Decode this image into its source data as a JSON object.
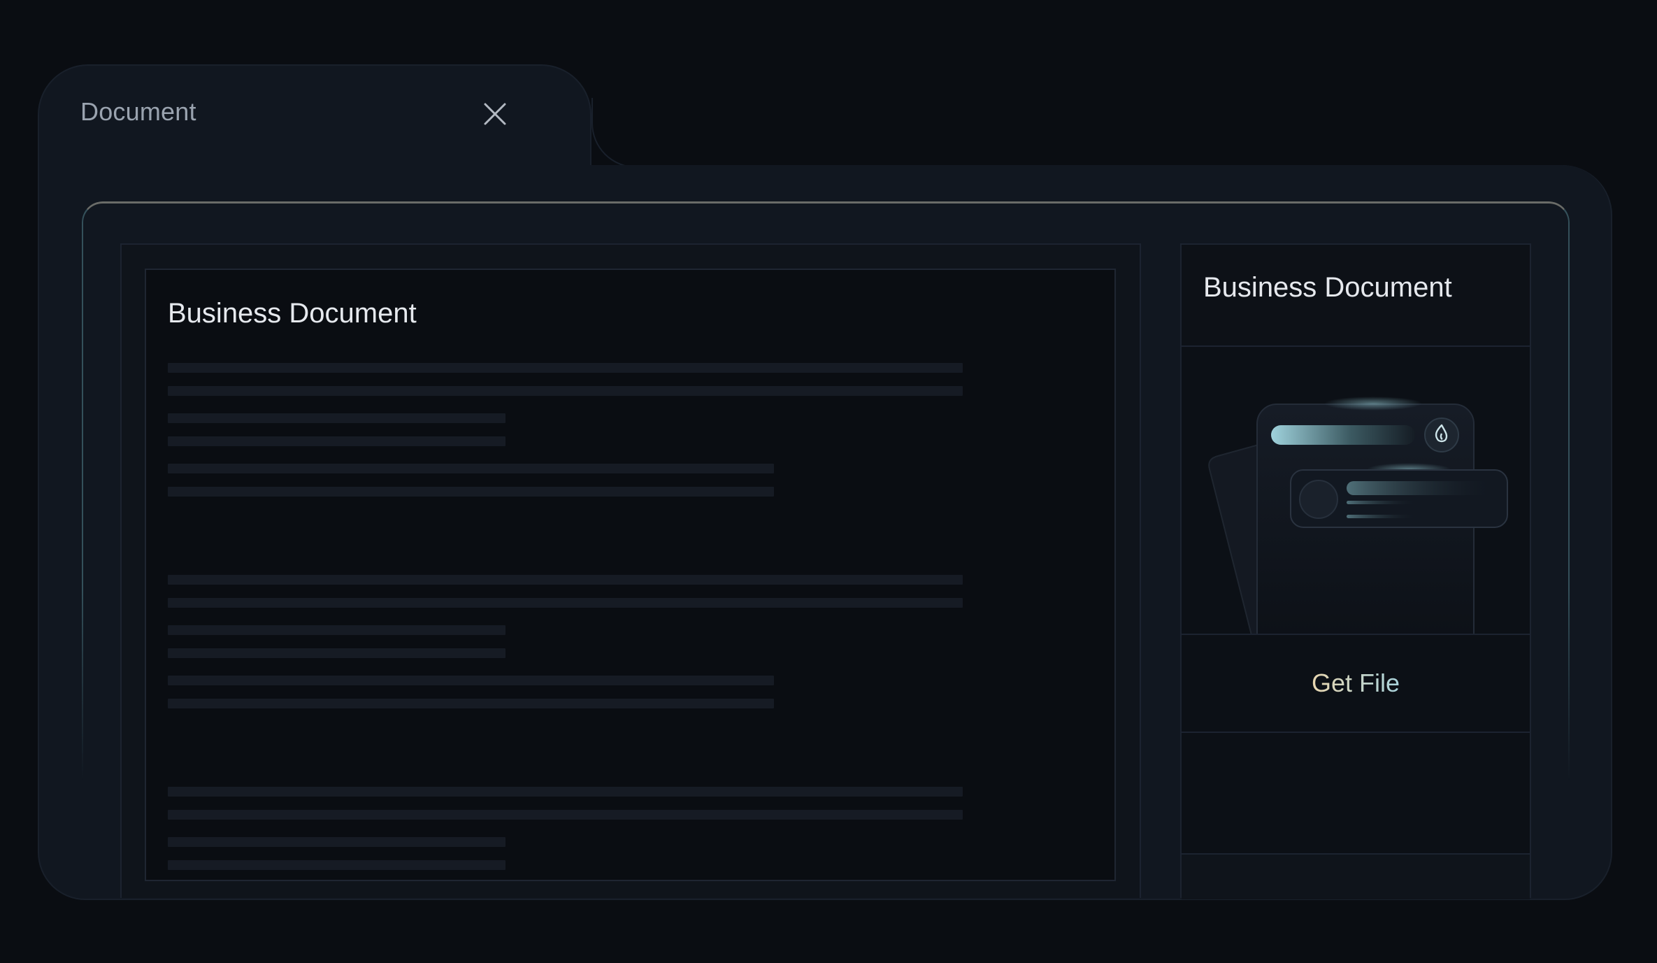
{
  "window": {
    "tab_title": "Document",
    "close_icon": "close-icon"
  },
  "document": {
    "title": "Business Document",
    "placeholder_line_groups": 3
  },
  "sidebar": {
    "title": "Business Document",
    "action_label": "Get File",
    "illustration_icon": "flame-icon"
  },
  "colors": {
    "background": "#0a0d12",
    "window": "#111720",
    "accent_teal": "#8fc3cc",
    "accent_sand": "#e8d6b0"
  }
}
